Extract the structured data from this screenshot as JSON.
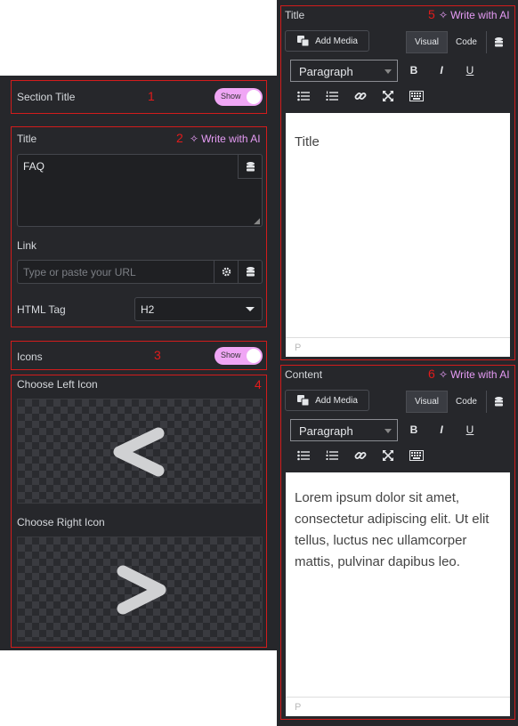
{
  "left_panel": {
    "section_title": {
      "number": "1",
      "label": "Section Title",
      "toggle": "Show"
    },
    "title_group": {
      "number": "2",
      "title_label": "Title",
      "write_ai": "Write with AI",
      "title_value": "FAQ",
      "link_label": "Link",
      "link_placeholder": "Type or paste your URL",
      "html_tag_label": "HTML Tag",
      "html_tag_value": "H2"
    },
    "icons": {
      "number": "3",
      "label": "Icons",
      "toggle": "Show"
    },
    "icon_choice": {
      "number": "4",
      "left_label": "Choose Left Icon",
      "left_glyph": "<",
      "right_label": "Choose Right Icon",
      "right_glyph": ">"
    }
  },
  "right_panel": {
    "title_editor": {
      "number": "5",
      "label": "Title",
      "write_ai": "Write with AI",
      "add_media": "Add Media",
      "tab_visual": "Visual",
      "tab_code": "Code",
      "format": "Paragraph",
      "content": "Title",
      "status": "P"
    },
    "content_editor": {
      "number": "6",
      "label": "Content",
      "write_ai": "Write with AI",
      "add_media": "Add Media",
      "tab_visual": "Visual",
      "tab_code": "Code",
      "format": "Paragraph",
      "content": "Lorem ipsum dolor sit amet, consectetur adipiscing elit. Ut elit tellus, luctus nec ullamcorper mattis, pulvinar dapibus leo.",
      "status": "P"
    },
    "toolbar": {
      "bold": "B",
      "italic": "I",
      "underline": "U"
    }
  },
  "colors": {
    "panel_bg": "#26272b",
    "annotation": "#d21c1c",
    "ai_accent": "#e69cf5",
    "toggle_on": "#f0a6f5"
  }
}
